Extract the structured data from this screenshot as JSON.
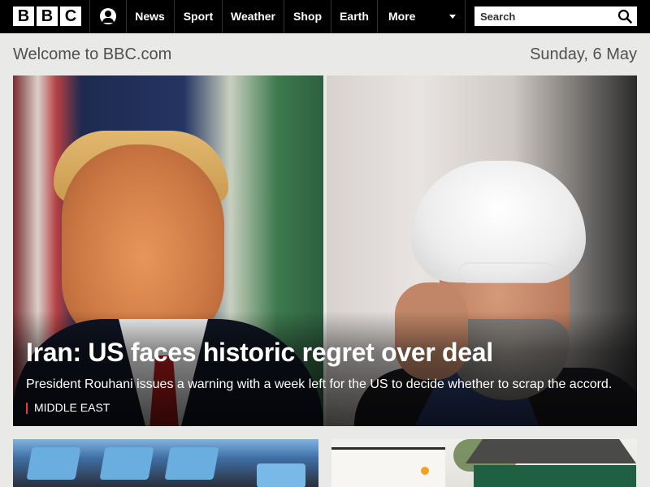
{
  "header": {
    "logo_letters": [
      "B",
      "B",
      "C"
    ],
    "nav": [
      {
        "label": "News"
      },
      {
        "label": "Sport"
      },
      {
        "label": "Weather"
      },
      {
        "label": "Shop"
      },
      {
        "label": "Earth"
      },
      {
        "label": "More"
      }
    ],
    "search": {
      "placeholder": "Search"
    },
    "icons": {
      "account": "account-icon",
      "search": "search-icon",
      "more": "chevron-down-icon"
    }
  },
  "welcome": {
    "text": "Welcome to BBC.com",
    "date": "Sunday, 6 May"
  },
  "hero": {
    "headline": "Iran: US faces historic regret over deal",
    "summary": "President Rouhani issues a warning with a week left for the US to decide whether to scrap the accord.",
    "tag": "MIDDLE EAST",
    "tag_color": "#e53935"
  },
  "colors": {
    "topbar": "#000000",
    "page_bg": "#e9e9e7",
    "text_muted": "#505050"
  }
}
